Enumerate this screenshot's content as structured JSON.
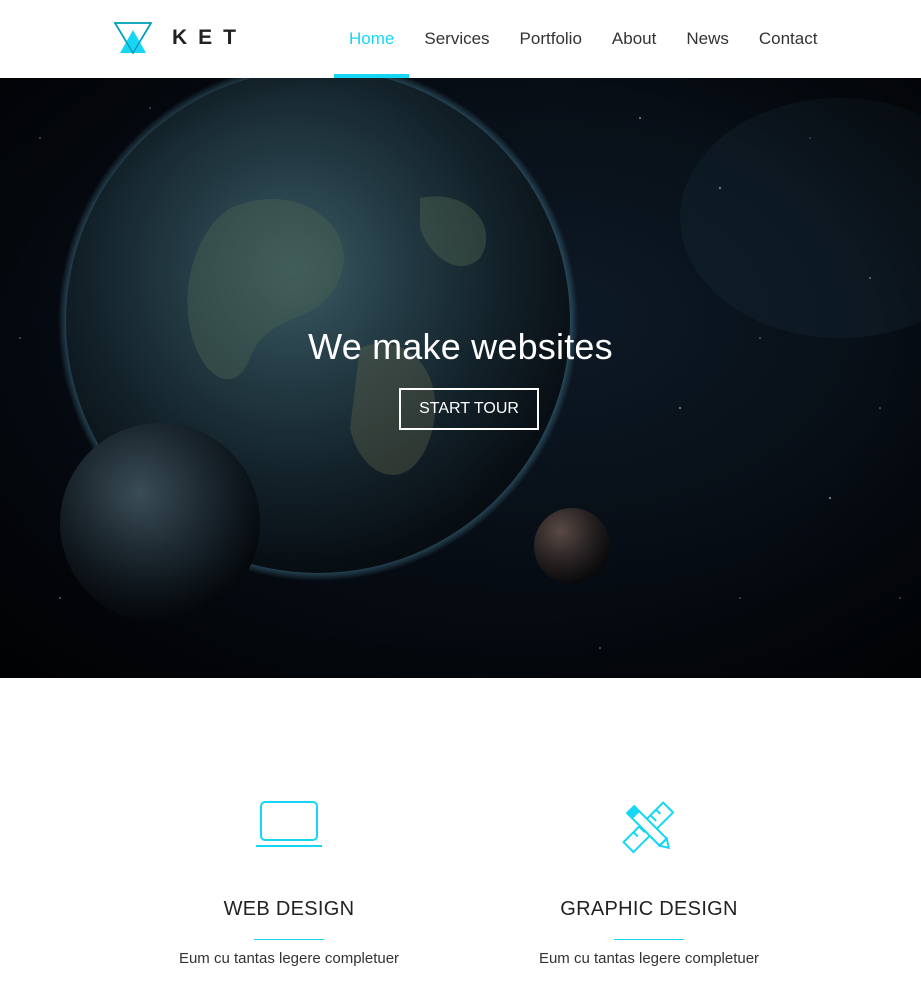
{
  "brand": {
    "name": "KET",
    "accent_color": "#16d6f5",
    "logo_icon": "triangle-logo-icon"
  },
  "nav": {
    "items": [
      {
        "label": "Home",
        "active": true
      },
      {
        "label": "Services",
        "active": false
      },
      {
        "label": "Portfolio",
        "active": false
      },
      {
        "label": "About",
        "active": false
      },
      {
        "label": "News",
        "active": false
      },
      {
        "label": "Contact",
        "active": false
      }
    ]
  },
  "hero": {
    "title": "We make websites",
    "button_label": "START TOUR",
    "background": "space-earth-planets"
  },
  "services": [
    {
      "icon": "laptop-icon",
      "title": "WEB DESIGN",
      "description": "Eum cu tantas legere completuer"
    },
    {
      "icon": "pencil-ruler-icon",
      "title": "GRAPHIC DESIGN",
      "description": "Eum cu tantas legere completuer"
    }
  ]
}
